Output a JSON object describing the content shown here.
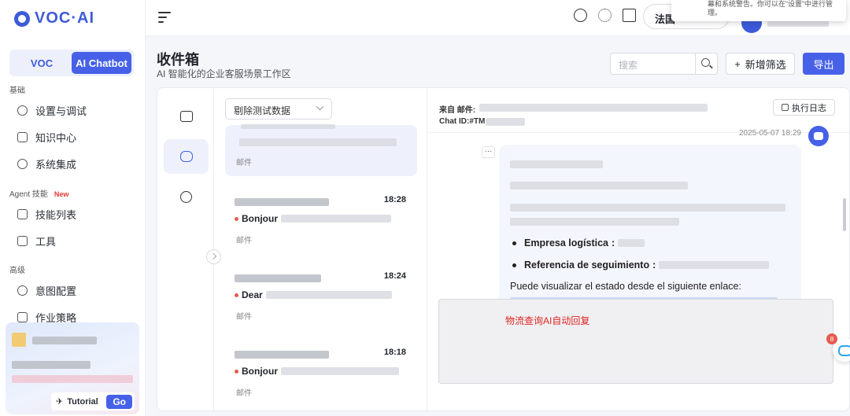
{
  "brand": {
    "logo_text": "VOC·AI"
  },
  "mode_switch": {
    "voc_label": "VOC",
    "chatbot_label": "AI Chatbot"
  },
  "sidebar": {
    "sections": [
      {
        "label": "基础"
      },
      {
        "label": "Agent 技能",
        "badge": "New"
      },
      {
        "label": "高级"
      }
    ],
    "items": [
      {
        "label": "设置与调试",
        "icon": "gear-icon"
      },
      {
        "label": "知识中心",
        "icon": "book-icon"
      },
      {
        "label": "系统集成",
        "icon": "share-icon"
      },
      {
        "label": "技能列表",
        "icon": "skill-icon"
      },
      {
        "label": "工具",
        "icon": "toolbox-icon"
      },
      {
        "label": "意图配置",
        "icon": "bulb-icon"
      },
      {
        "label": "作业策略",
        "icon": "strategy-icon"
      }
    ],
    "promo": {
      "tutorial_label": "Tutorial",
      "go_label": "Go"
    }
  },
  "header": {
    "language_label": "法国",
    "toast_text": "幕和系统警告。你可以在“设置”中进行管理。"
  },
  "page": {
    "title": "收件箱",
    "subtitle": "AI 智能化的企业客服场景工作区",
    "search_placeholder": "搜索",
    "add_filter_label": "新增筛选",
    "export_label": "导出"
  },
  "inbox": {
    "filter_value": "剔除测试数据",
    "items": [
      {
        "time": "",
        "subject": "",
        "channel": "邮件",
        "selected": true
      },
      {
        "time": "18:28",
        "subject": "Bonjour",
        "channel": "邮件"
      },
      {
        "time": "18:24",
        "subject": "Dear",
        "channel": "邮件"
      },
      {
        "time": "18:18",
        "subject": "Bonjour",
        "channel": "邮件"
      }
    ]
  },
  "detail": {
    "from_label": "来自 邮件:",
    "chat_id_label": "Chat ID:#TM",
    "exec_log_label": "执行日志",
    "message_time": "2025-05-07 18:29",
    "more_label": "···",
    "bullets": [
      {
        "label": "Empresa logística",
        "suffix": ":"
      },
      {
        "label": "Referencia de seguimiento",
        "suffix": ":"
      }
    ],
    "link_intro": "Puede visualizar el estado desde el siguiente enlace:",
    "reply_note": "物流查询AI自动回复"
  },
  "float_badge": "8",
  "colors": {
    "accent": "#4661e8",
    "brand": "#3d5bd9",
    "note_red": "#e02424"
  }
}
